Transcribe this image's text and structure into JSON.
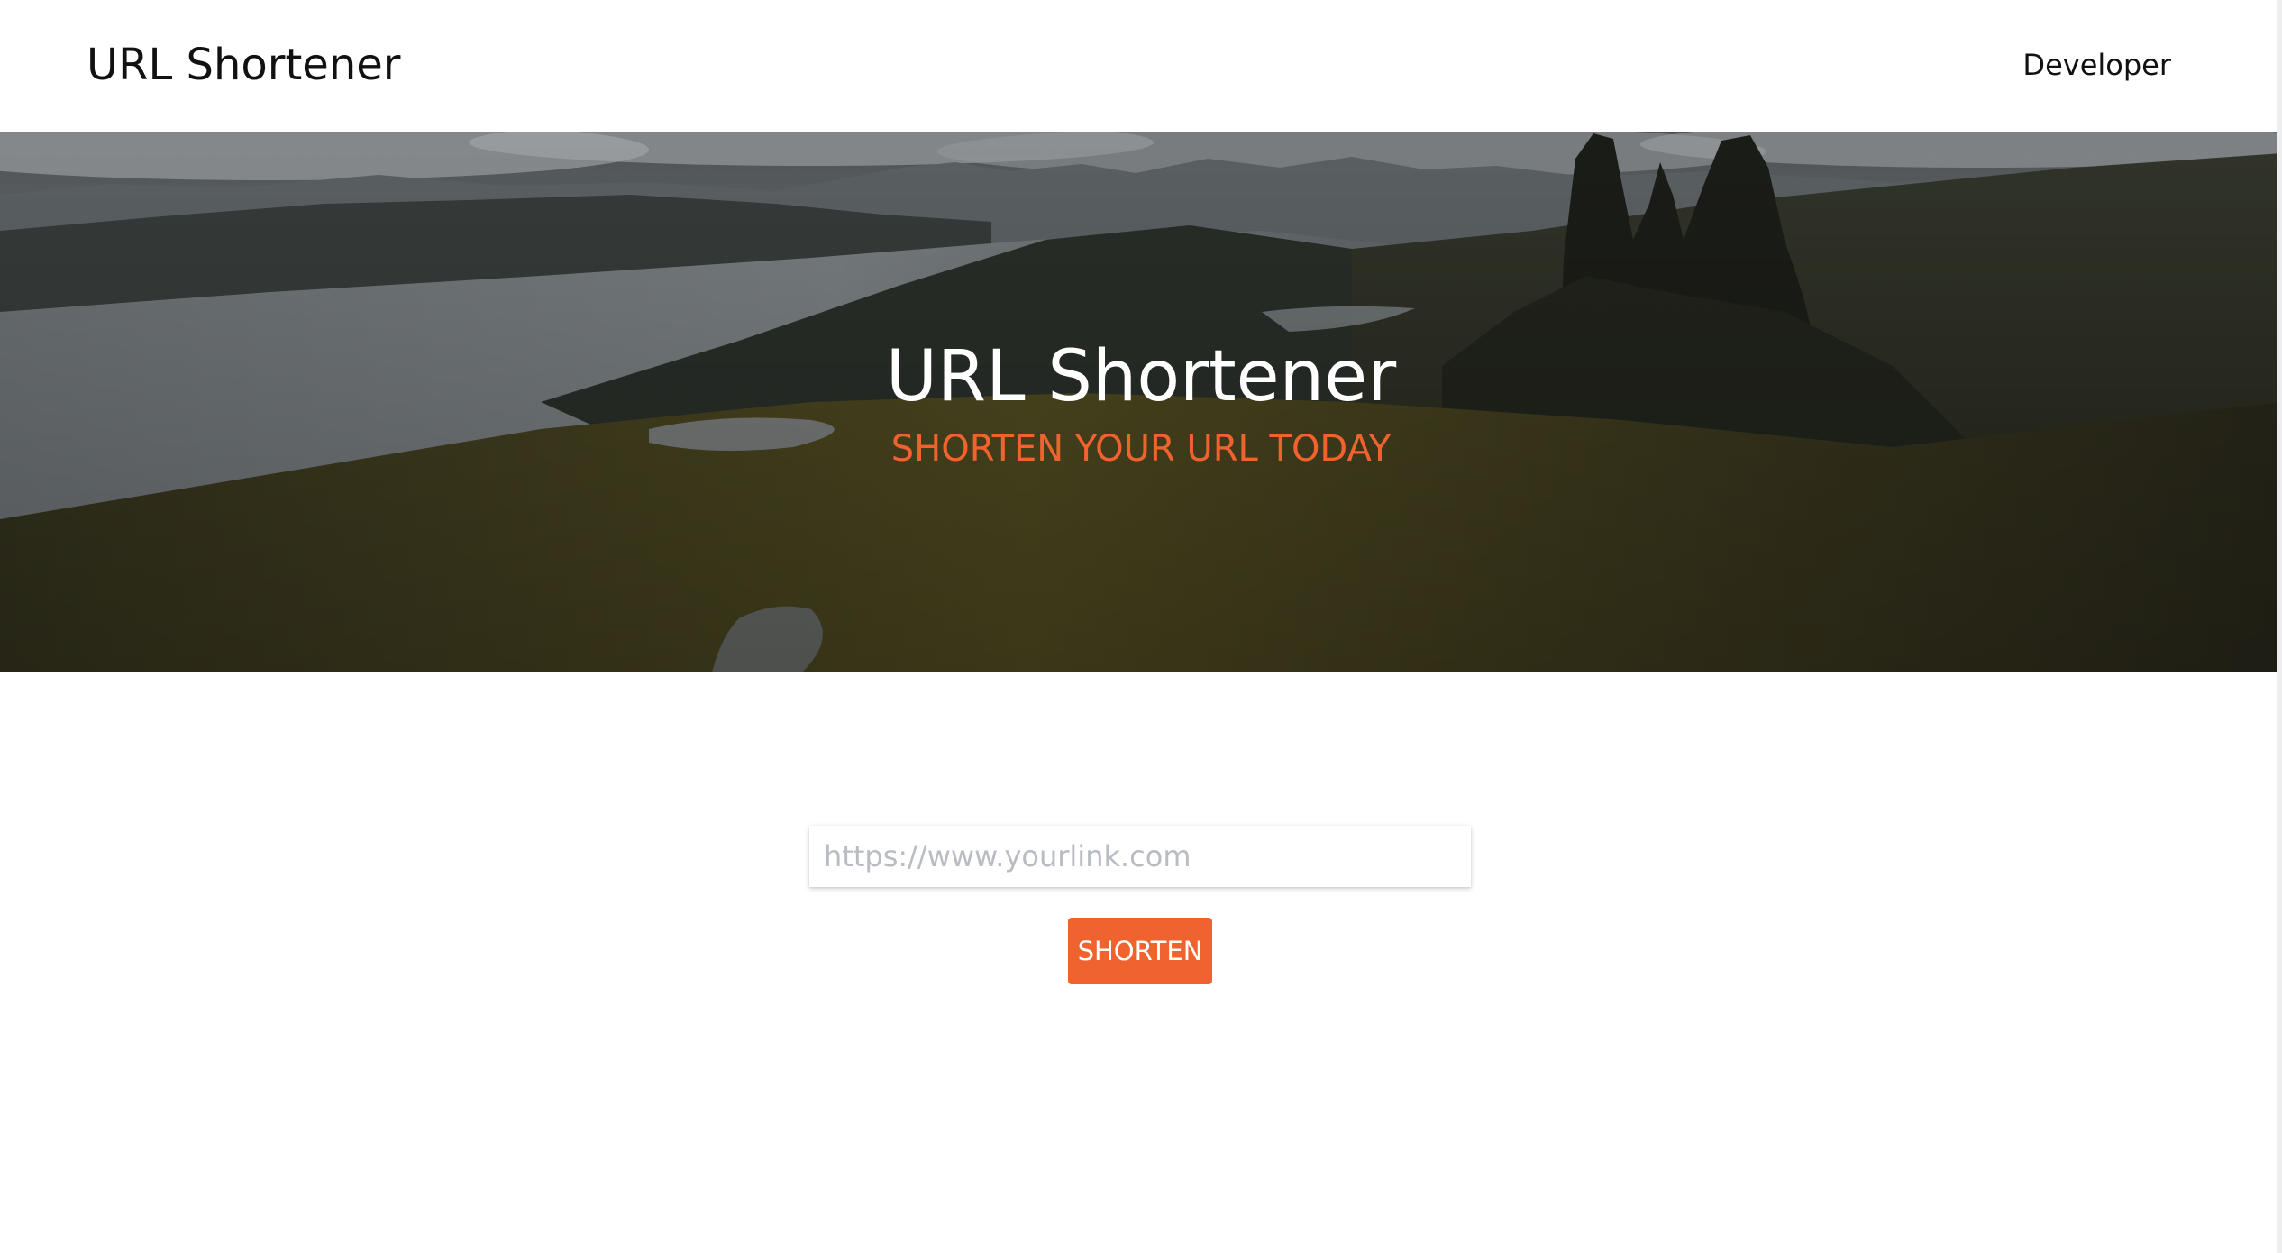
{
  "navbar": {
    "brand": "URL Shortener",
    "developer_link": "Developer"
  },
  "hero": {
    "title": "URL Shortener",
    "subtitle": "SHORTEN YOUR URL TODAY",
    "subtitle_color": "#f0632f"
  },
  "form": {
    "url_input_placeholder": "https://www.yourlink.com",
    "url_input_value": "",
    "shorten_label": "SHORTEN"
  },
  "colors": {
    "accent": "#f0632f",
    "background": "#ffffff",
    "text": "#111111"
  }
}
